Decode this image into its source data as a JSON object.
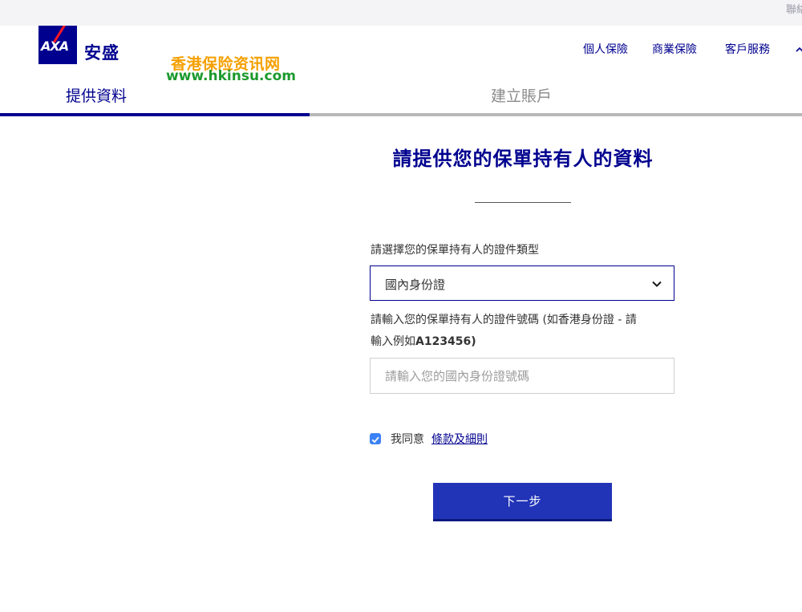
{
  "topbar": {
    "link": "聯絡"
  },
  "brand": {
    "logo_text": "AXA",
    "name_cn": "安盛"
  },
  "watermark": {
    "title": "香港保险资讯网",
    "url": "www.hkinsu.com"
  },
  "nav": {
    "items": [
      "個人保險",
      "商業保險",
      "客戶服務"
    ],
    "more_icon": "chevron-up-icon"
  },
  "steps": {
    "items": [
      "提供資料",
      "建立賬戶"
    ],
    "active_index": 0,
    "progress_fraction": 0.386
  },
  "form": {
    "title": "請提供您的保單持有人的資料",
    "id_type_label": "請選擇您的保單持有人的證件類型",
    "id_type_value": "國內身份證",
    "id_number_label_line1": "請輸入您的保單持有人的證件號碼 (如香港身份證 - 請",
    "id_number_label_line2_pre": "輸入例如",
    "id_number_label_line2_bold": "A123456)",
    "id_number_placeholder": "請輸入您的國內身份證號碼",
    "id_number_value": "",
    "agree_text": "我同意",
    "terms_link": "條款及細則",
    "agree_checked": true,
    "next_button": "下一步"
  },
  "colors": {
    "brand_blue": "#00008f",
    "axa_red": "#ff1721",
    "button_blue": "#2134b8",
    "checkbox_blue": "#3b82f6",
    "watermark_orange": "#f5a000",
    "watermark_green": "#1d9a2e"
  }
}
